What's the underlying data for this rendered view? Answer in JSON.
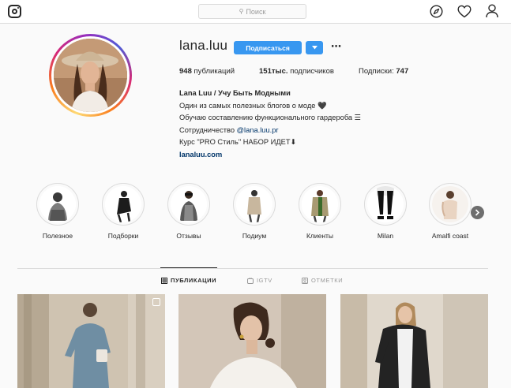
{
  "search": {
    "placeholder": "Поиск"
  },
  "profile": {
    "username": "lana.luu",
    "follow_label": "Подписаться",
    "stats": {
      "posts_count": "948",
      "posts_label": "публикаций",
      "followers_count": "151тыс.",
      "followers_label": "подписчиков",
      "following_label": "Подписки:",
      "following_count": "747"
    },
    "bio": {
      "name": "Lana Luu / Учу Быть Модными",
      "line1": "Один из самых полезных блогов о моде 🖤",
      "line2": "Обучаю составлению функционального гардероба ☰",
      "line3_prefix": "Сотрудничество ",
      "line3_handle": "@lana.luu.pr",
      "line4": "Курс \"PRO Стиль\" НАБОР ИДЕТ⬇",
      "website": "lanaluu.com"
    }
  },
  "highlights": [
    {
      "label": "Полезное"
    },
    {
      "label": "Подборки"
    },
    {
      "label": "Отзывы"
    },
    {
      "label": "Подиум"
    },
    {
      "label": "Клиенты"
    },
    {
      "label": "Milan"
    },
    {
      "label": "Amalfi coast"
    }
  ],
  "tabs": {
    "posts": "ПУБЛИКАЦИИ",
    "igtv": "IGTV",
    "tagged": "ОТМЕТКИ"
  },
  "colors": {
    "accent": "#3897f0",
    "link": "#003569",
    "border": "#dbdbdb"
  }
}
